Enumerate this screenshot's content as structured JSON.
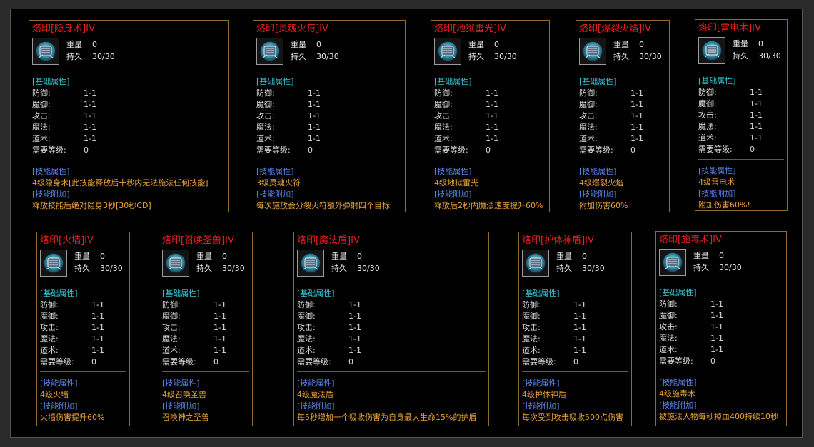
{
  "labels": {
    "weight": "重量",
    "durability": "持久",
    "basic_attrs": "[基础属性]",
    "skill_attrs": "[技能属性]",
    "skill_extra": "[技能附加]",
    "attr_names": [
      "防御:",
      "魔御:",
      "攻击:",
      "魔法:",
      "道术:",
      "需要等级:"
    ]
  },
  "colors": {
    "title": "#e5211d",
    "section": "#37c3d8",
    "skill_section": "#5b85e6",
    "skill_text": "#e9a23b",
    "border": "#8b6d2e"
  },
  "item_icon": "brand-seal-gem-icon",
  "cards": [
    {
      "title": "烙印[隐身术]IV",
      "weight": "0",
      "durability": "30/30",
      "attrs": [
        "1-1",
        "1-1",
        "1-1",
        "1-1",
        "1-1",
        "0"
      ],
      "skill": "4级隐身术[此技能释放后十秒内无法施法任何技能]",
      "extra": "释放技能后绝对隐身3秒[30秒CD]"
    },
    {
      "title": "烙印[灵魂火符]IV",
      "weight": "0",
      "durability": "30/30",
      "attrs": [
        "1-1",
        "1-1",
        "1-1",
        "1-1",
        "1-1",
        "0"
      ],
      "skill": "3级灵魂火符",
      "extra": "每次施放会分裂火符额外弹射四个目标"
    },
    {
      "title": "烙印[地狱雷光]IV",
      "weight": "0",
      "durability": "30/30",
      "attrs": [
        "1-1",
        "1-1",
        "1-1",
        "1-1",
        "1-1",
        "0"
      ],
      "skill": "4级地狱雷光",
      "extra": "释放后2秒内魔法速度提升60%"
    },
    {
      "title": "烙印[爆裂火焰]IV",
      "weight": "0",
      "durability": "30/30",
      "attrs": [
        "1-1",
        "1-1",
        "1-1",
        "1-1",
        "1-1",
        "0"
      ],
      "skill": "4级爆裂火焰",
      "extra": "附加伤害60%"
    },
    {
      "title": "烙印[雷电术]IV",
      "weight": "0",
      "durability": "30/30",
      "attrs": [
        "1-1",
        "1-1",
        "1-1",
        "1-1",
        "1-1",
        "0"
      ],
      "skill": "4级雷电术",
      "extra": "附加伤害60%!"
    },
    {
      "title": "烙印[火墙]IV",
      "weight": "0",
      "durability": "30/30",
      "attrs": [
        "1-1",
        "1-1",
        "1-1",
        "1-1",
        "1-1",
        "0"
      ],
      "skill": "4级火墙",
      "extra": "火墙伤害提升60%"
    },
    {
      "title": "烙印[召唤圣兽]IV",
      "weight": "0",
      "durability": "30/30",
      "attrs": [
        "1-1",
        "1-1",
        "1-1",
        "1-1",
        "1-1",
        "0"
      ],
      "skill": "4级召唤圣兽",
      "extra": "召唤神之圣兽"
    },
    {
      "title": "烙印[魔法盾]IV",
      "weight": "0",
      "durability": "30/30",
      "attrs": [
        "1-1",
        "1-1",
        "1-1",
        "1-1",
        "1-1",
        "0"
      ],
      "skill": "4级魔法盾",
      "extra": "每5秒增加一个吸收伤害为自身最大生命15%的护盾"
    },
    {
      "title": "烙印[护体神盾]IV",
      "weight": "0",
      "durability": "30/30",
      "attrs": [
        "1-1",
        "1-1",
        "1-1",
        "1-1",
        "1-1",
        "0"
      ],
      "skill": "4级护体神盾",
      "extra": "每次受到攻击吸收500点伤害"
    },
    {
      "title": "烙印[施毒术]IV",
      "weight": "0",
      "durability": "30/30",
      "attrs": [
        "1-1",
        "1-1",
        "1-1",
        "1-1",
        "1-1",
        "0"
      ],
      "skill": "4级施毒术",
      "extra": "被施法人物每秒掉血400持续10秒"
    }
  ]
}
